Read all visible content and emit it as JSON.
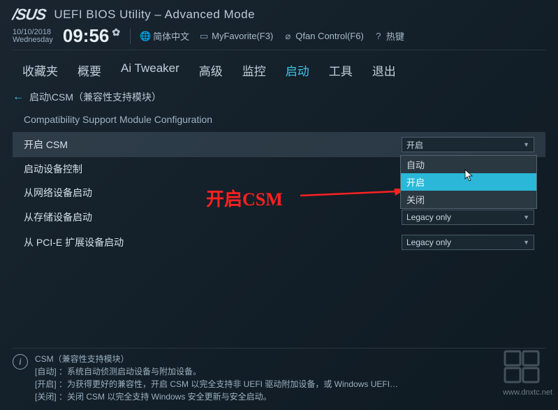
{
  "header": {
    "brand": "/SUS",
    "title": "UEFI BIOS Utility – Advanced Mode",
    "date": "10/10/2018",
    "weekday": "Wednesday",
    "time": "09:56",
    "language": "简体中文",
    "myfavorite": "MyFavorite(F3)",
    "qfan": "Qfan Control(F6)",
    "hotkey": "热键"
  },
  "tabs": [
    {
      "label": "收藏夹",
      "active": false
    },
    {
      "label": "概要",
      "active": false
    },
    {
      "label": "Ai Tweaker",
      "active": false
    },
    {
      "label": "高级",
      "active": false
    },
    {
      "label": "监控",
      "active": false
    },
    {
      "label": "启动",
      "active": true
    },
    {
      "label": "工具",
      "active": false
    },
    {
      "label": "退出",
      "active": false
    }
  ],
  "breadcrumb": "启动\\CSM（兼容性支持模块）",
  "section_title": "Compatibility Support Module Configuration",
  "options": [
    {
      "label": "开启 CSM",
      "value": "开启",
      "selected": true
    },
    {
      "label": "启动设备控制",
      "value": ""
    },
    {
      "label": "从网络设备启动",
      "value": ""
    },
    {
      "label": "从存储设备启动",
      "value": "Legacy only"
    },
    {
      "label": "从 PCI-E 扩展设备启动",
      "value": "Legacy only"
    }
  ],
  "dropdown": {
    "items": [
      "自动",
      "开启",
      "关闭"
    ],
    "highlighted": "开启"
  },
  "annotation_text": "开启CSM",
  "help": {
    "title": "CSM（兼容性支持模块）",
    "lines": [
      "[自动] ：系统自动侦测启动设备与附加设备。",
      "[开启] ：为获得更好的兼容性，开启 CSM 以完全支持非 UEFI 驱动附加设备，或 Windows UEFI…",
      "[关闭] ：关闭 CSM 以完全支持 Windows 安全更新与安全启动。"
    ]
  },
  "watermark_url": "www.dnxtc.net"
}
